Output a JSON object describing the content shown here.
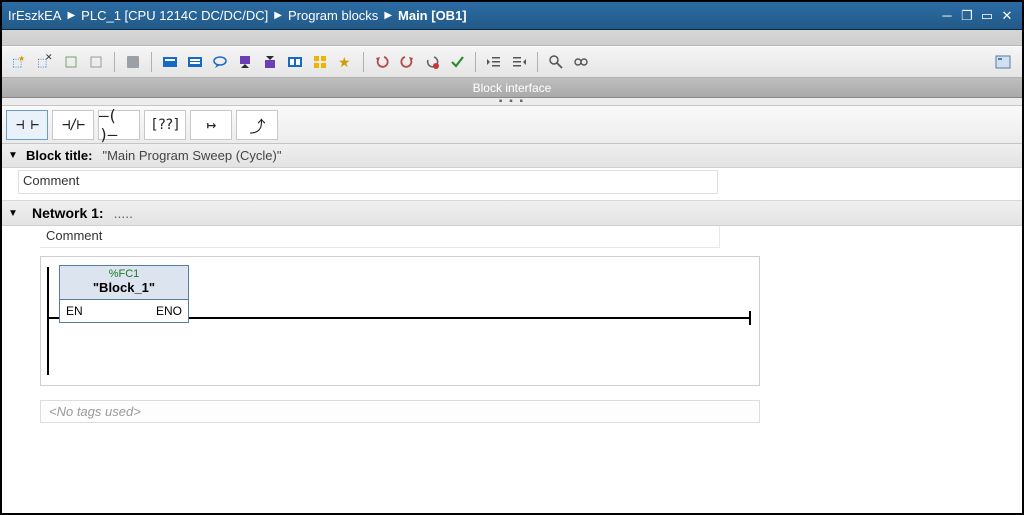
{
  "breadcrumbs": [
    "IrEszkEA",
    "PLC_1 [CPU 1214C DC/DC/DC]",
    "Program blocks",
    "Main [OB1]"
  ],
  "section_bar": "Block interface",
  "block_title": {
    "label": "Block title:",
    "value": "\"Main Program Sweep (Cycle)\"",
    "comment": "Comment"
  },
  "network": {
    "label": "Network 1:",
    "subtitle": ".....",
    "comment": "Comment",
    "call": {
      "address": "%FC1",
      "name": "\"Block_1\"",
      "port_in": "EN",
      "port_out": "ENO"
    },
    "tags": "<No tags used>"
  },
  "palette": {
    "contact_no": "⊣ ⊢",
    "contact_nc": "⊣/⊢",
    "coil": "⟜⟞",
    "box": "[??]",
    "branch_open": "↦",
    "branch_close": "↲"
  }
}
